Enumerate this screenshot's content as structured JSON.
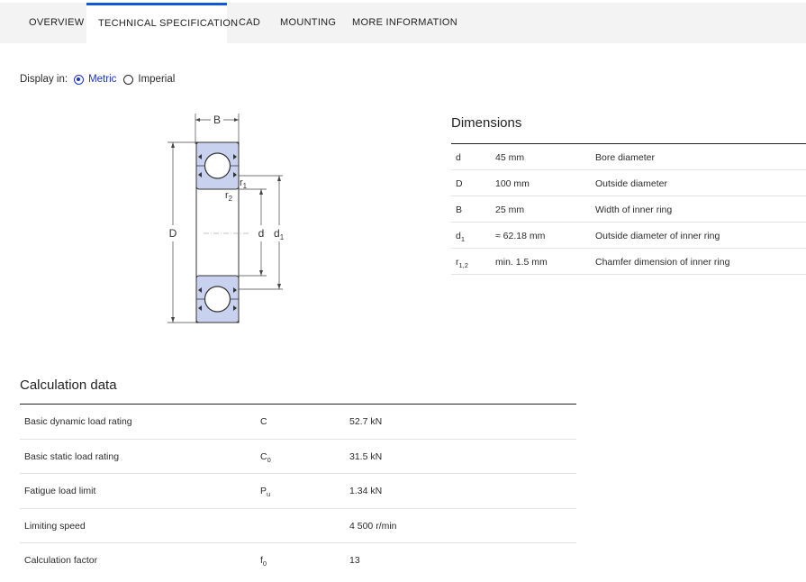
{
  "tabs": [
    {
      "label": "OVERVIEW"
    },
    {
      "label": "TECHNICAL SPECIFICATION"
    },
    {
      "label": "CAD"
    },
    {
      "label": "MOUNTING"
    },
    {
      "label": "MORE INFORMATION"
    }
  ],
  "active_tab": "TECHNICAL SPECIFICATION",
  "display": {
    "label": "Display in:",
    "options": [
      {
        "label": "Metric",
        "selected": true
      },
      {
        "label": "Imperial",
        "selected": false
      }
    ]
  },
  "diagram": {
    "labels": {
      "B": "B",
      "D": "D",
      "d": "d",
      "d1": "d",
      "d1_sub": "1",
      "r1": "r",
      "r1_sub": "1",
      "r2": "r",
      "r2_sub": "2"
    }
  },
  "dimensions": {
    "title": "Dimensions",
    "rows": [
      {
        "symbol": "d",
        "sub": "",
        "value": "45 mm",
        "description": "Bore diameter"
      },
      {
        "symbol": "D",
        "sub": "",
        "value": "100 mm",
        "description": "Outside diameter"
      },
      {
        "symbol": "B",
        "sub": "",
        "value": "25 mm",
        "description": "Width of inner ring"
      },
      {
        "symbol": "d",
        "sub": "1",
        "value": "≈ 62.18 mm",
        "description": "Outside diameter of inner ring"
      },
      {
        "symbol": "r",
        "sub": "1,2",
        "value": "min. 1.5 mm",
        "description": "Chamfer dimension of inner ring"
      }
    ]
  },
  "calculation": {
    "title": "Calculation data",
    "rows": [
      {
        "label": "Basic dynamic load rating",
        "symbol": "C",
        "sub": "",
        "value": "52.7 kN"
      },
      {
        "label": "Basic static load rating",
        "symbol": "C",
        "sub": "0",
        "value": "31.5 kN"
      },
      {
        "label": "Fatigue load limit",
        "symbol": "P",
        "sub": "u",
        "value": "1.34 kN"
      },
      {
        "label": "Limiting speed",
        "symbol": "",
        "sub": "",
        "value": "4 500 r/min"
      },
      {
        "label": "Calculation factor",
        "symbol": "f",
        "sub": "0",
        "value": "13"
      }
    ]
  },
  "colors": {
    "accent": "#0f58d6",
    "radio_selected": "#1a35c9",
    "tab_bg": "#f3f3f3",
    "bearing_fill": "#c8d2ef"
  }
}
